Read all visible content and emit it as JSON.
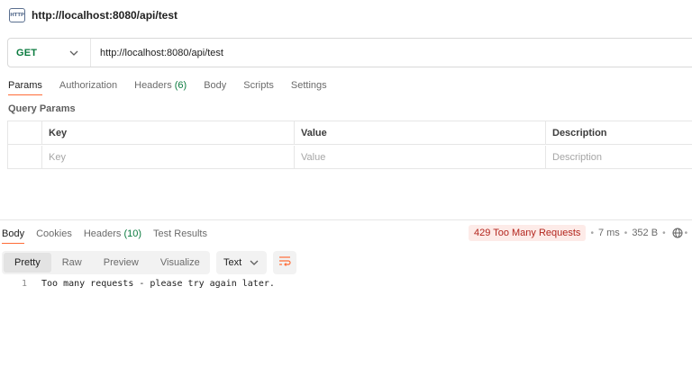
{
  "window": {
    "title": "http://localhost:8080/api/test",
    "icon_text": "HTTP"
  },
  "request": {
    "method": "GET",
    "url": "http://localhost:8080/api/test",
    "tabs": [
      {
        "label": "Params",
        "active": true
      },
      {
        "label": "Authorization"
      },
      {
        "label": "Headers",
        "count": "(6)"
      },
      {
        "label": "Body"
      },
      {
        "label": "Scripts"
      },
      {
        "label": "Settings"
      }
    ]
  },
  "query_params": {
    "section_label": "Query Params",
    "headers": [
      "Key",
      "Value",
      "Description"
    ],
    "placeholders": [
      "Key",
      "Value",
      "Description"
    ]
  },
  "response": {
    "tabs": [
      {
        "label": "Body",
        "active": true
      },
      {
        "label": "Cookies"
      },
      {
        "label": "Headers",
        "count": "(10)"
      },
      {
        "label": "Test Results"
      }
    ],
    "status": "429 Too Many Requests",
    "time": "7 ms",
    "size": "352 B",
    "formats": [
      "Pretty",
      "Raw",
      "Preview",
      "Visualize"
    ],
    "type": "Text",
    "lines": [
      {
        "no": "1",
        "text": "Too many requests - please try again later."
      }
    ]
  },
  "colors": {
    "accent": "#ff6c37",
    "method_get": "#0b7b3f",
    "error_status": "#b3261e",
    "error_bg": "#fdebe8"
  }
}
